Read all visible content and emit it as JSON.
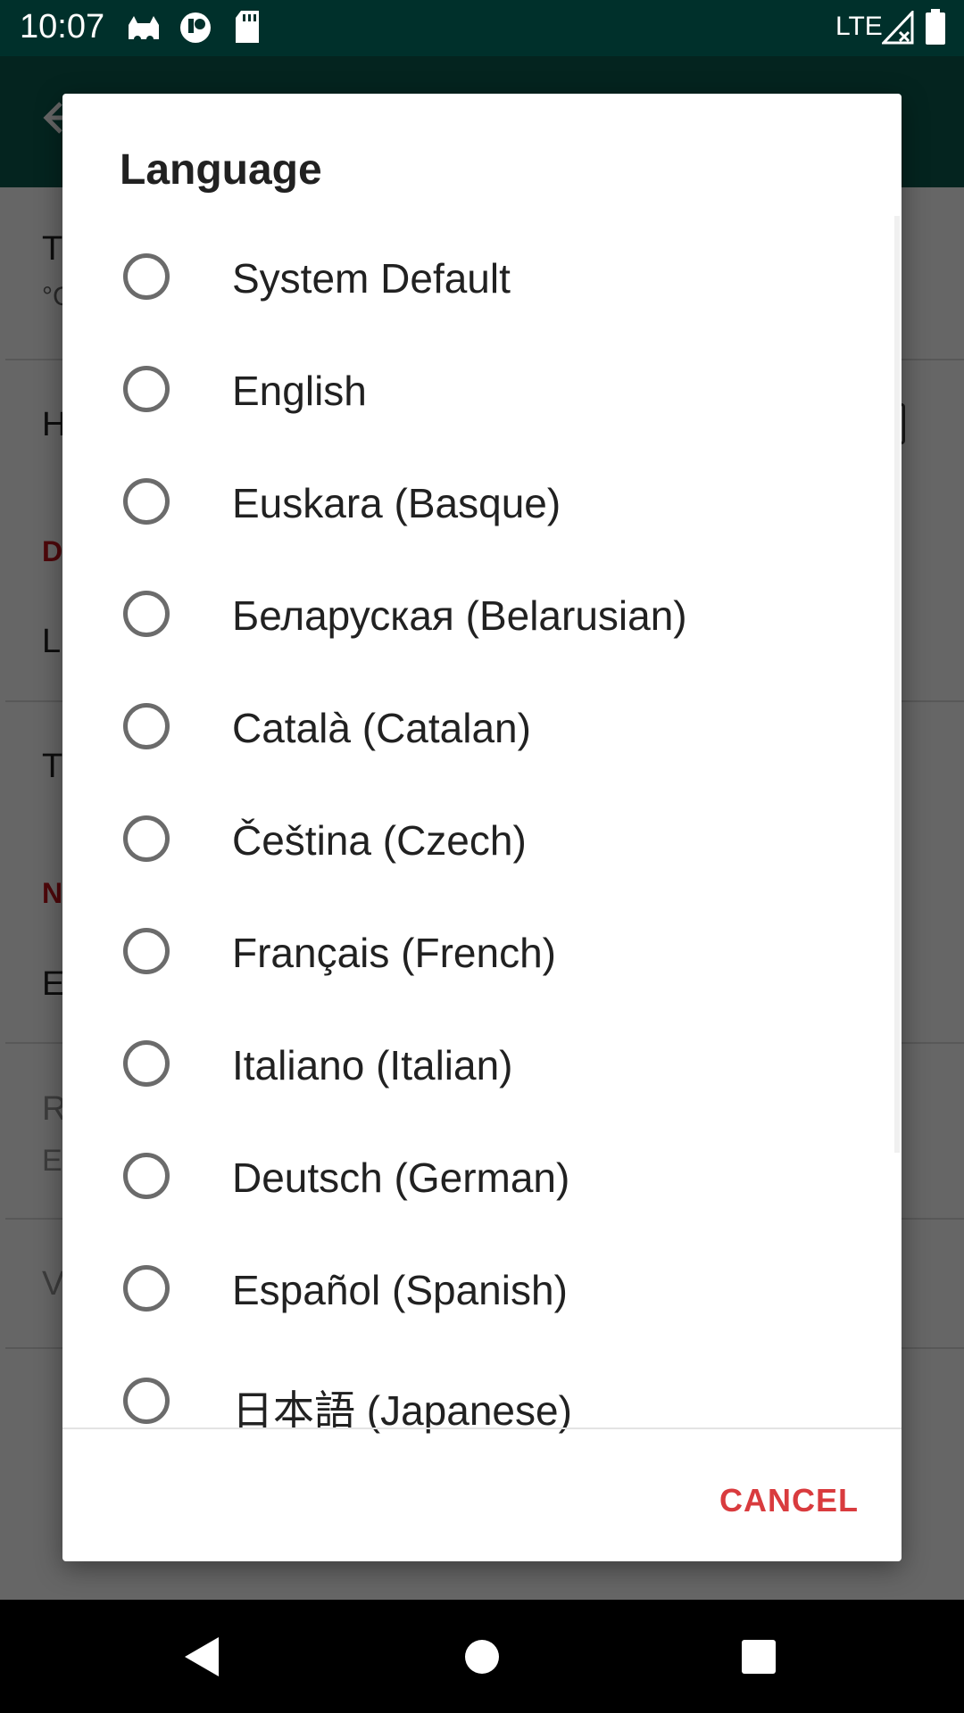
{
  "status_bar": {
    "time": "10:07",
    "network": "LTE",
    "icons": [
      "cat-icon",
      "notification-app-icon",
      "sd-card-icon",
      "signal-icon",
      "battery-icon"
    ]
  },
  "background": {
    "items": [
      {
        "text": "T",
        "sub": "°C"
      },
      {
        "text": "H"
      },
      {
        "header": "D"
      },
      {
        "text": "L"
      },
      {
        "text": "T"
      },
      {
        "header": "N"
      },
      {
        "text": "E"
      },
      {
        "text": "R",
        "sub": "E"
      },
      {
        "text": "V"
      }
    ]
  },
  "dialog": {
    "title": "Language",
    "options": [
      "System Default",
      "English",
      "Euskara (Basque)",
      "Беларуская (Belarusian)",
      "Català (Catalan)",
      "Čeština (Czech)",
      "Français (French)",
      "Italiano (Italian)",
      "Deutsch (German)",
      "Español (Spanish)",
      "日本語 (Japanese)"
    ],
    "cancel_label": "CANCEL"
  },
  "colors": {
    "status_bar": "#00302b",
    "app_bar": "#0b5a4e",
    "accent": "#d93b3e",
    "radio": "#6b6b6b"
  }
}
